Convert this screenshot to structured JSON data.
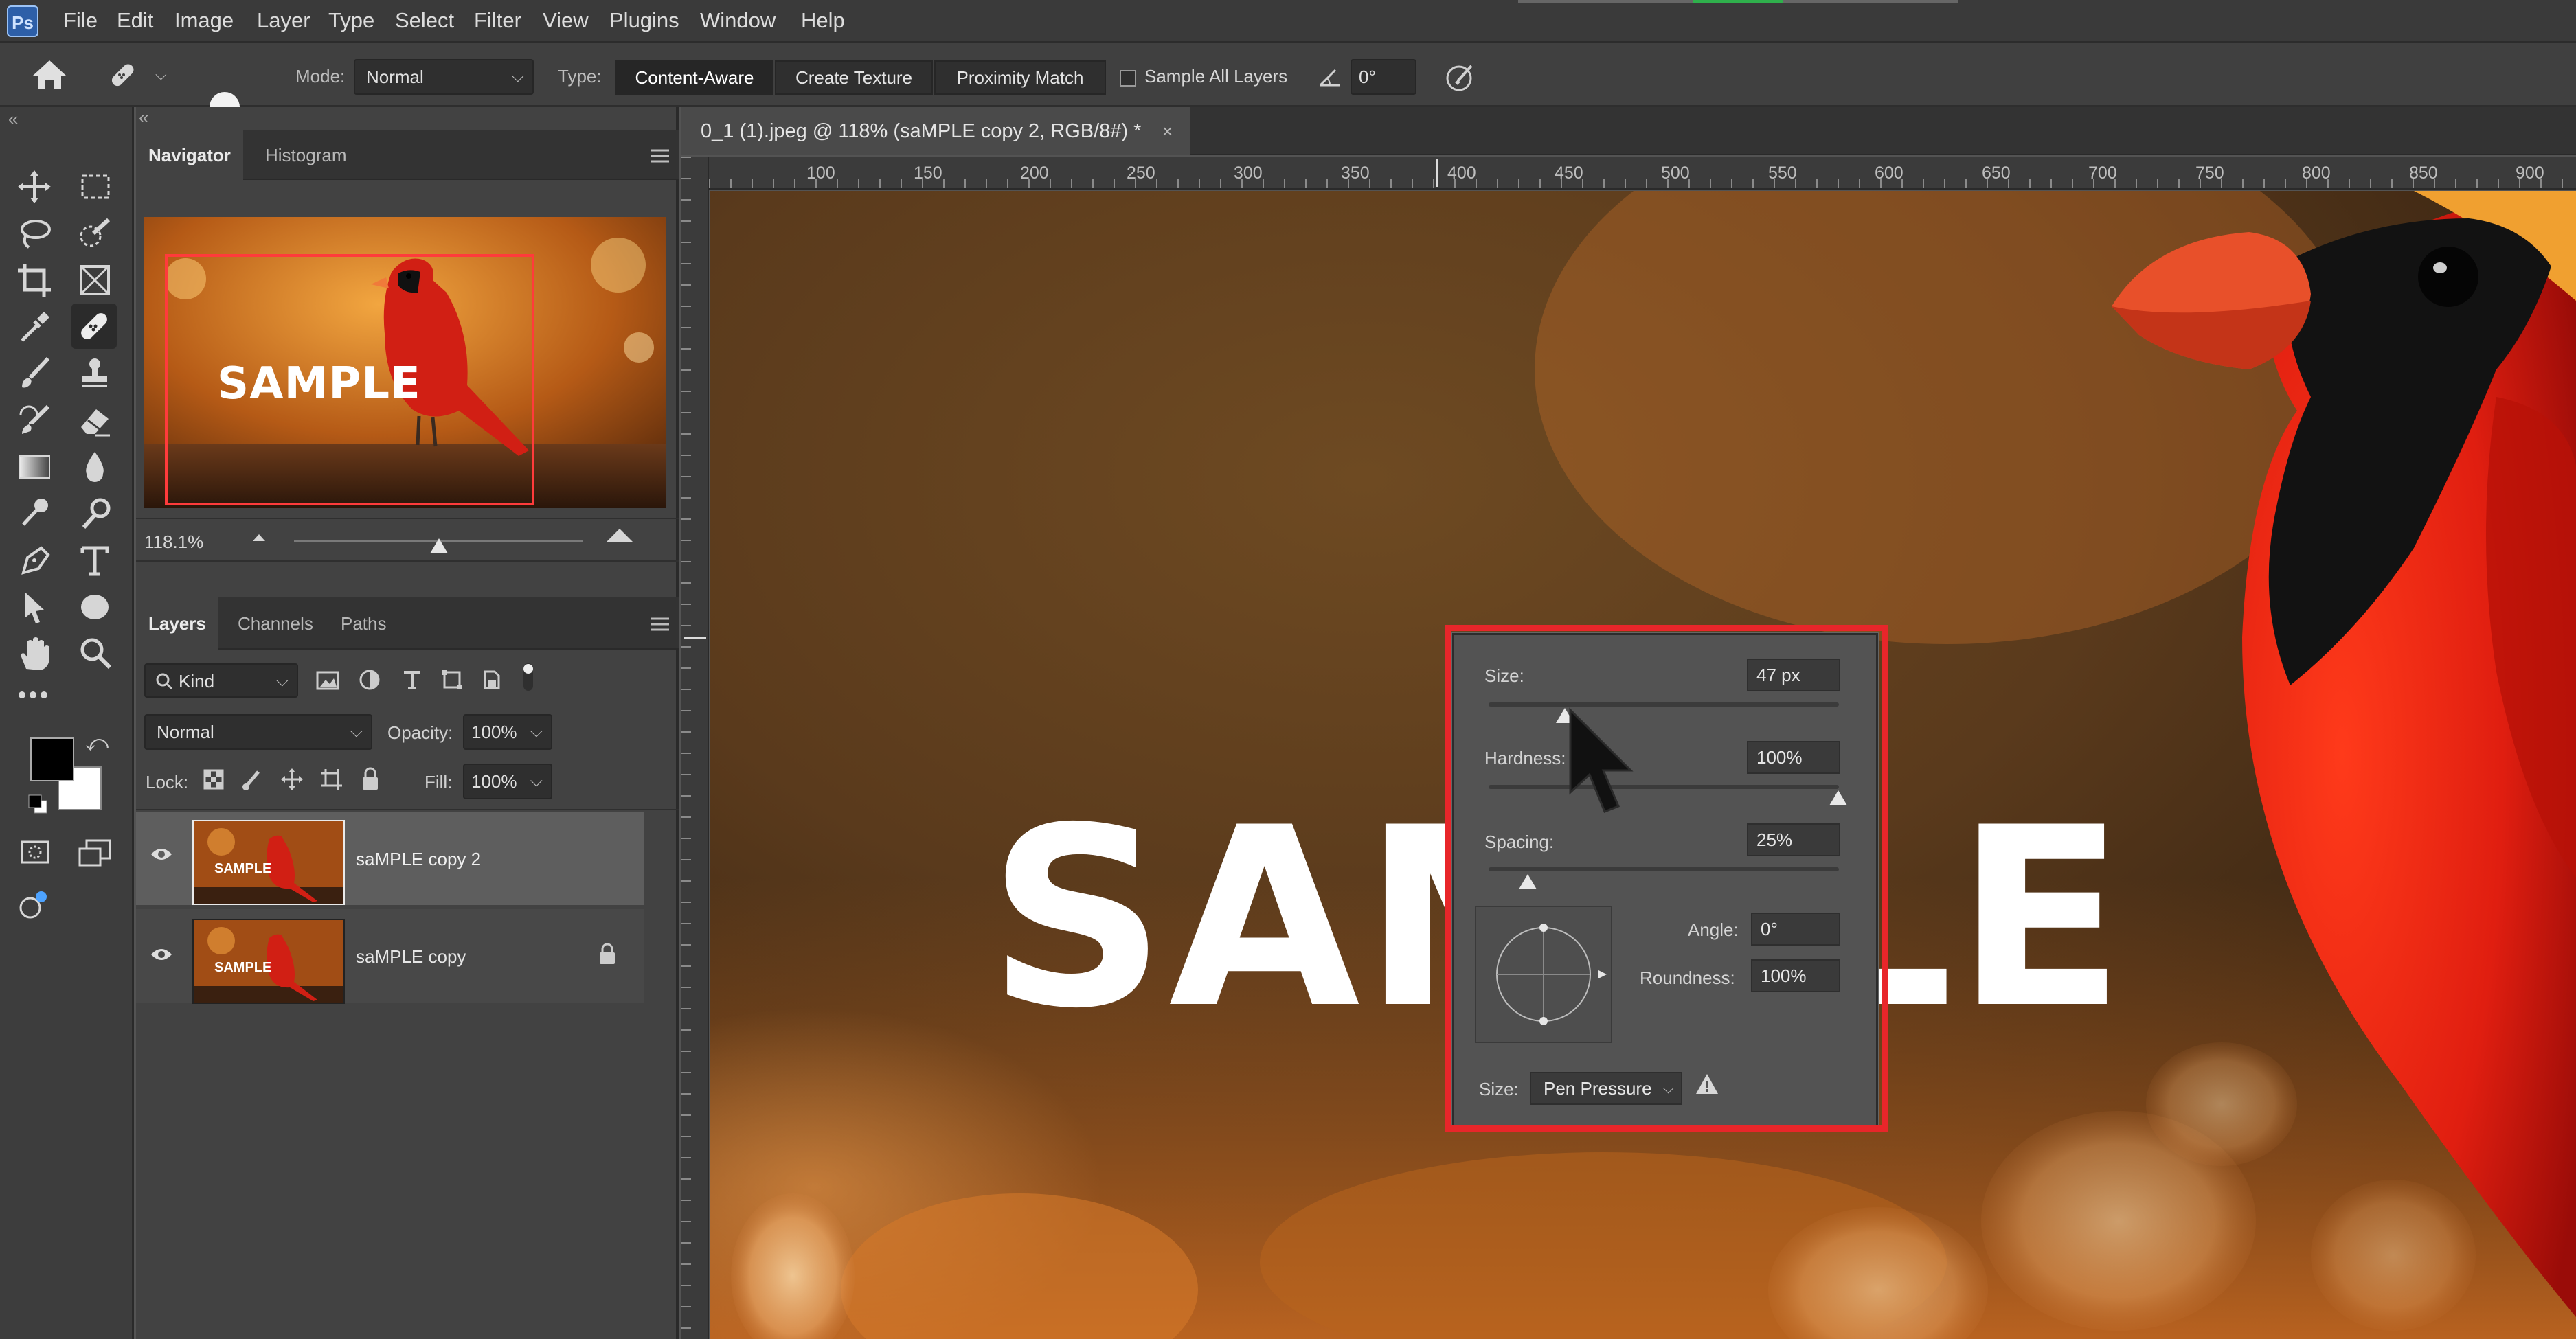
{
  "menubar": {
    "logo": "Ps",
    "items": [
      "File",
      "Edit",
      "Image",
      "Layer",
      "Type",
      "Select",
      "Filter",
      "View",
      "Plugins",
      "Window",
      "Help"
    ]
  },
  "options_bar": {
    "brush_size": "47",
    "mode_label": "Mode:",
    "mode_value": "Normal",
    "type_label": "Type:",
    "type_buttons": [
      "Content-Aware",
      "Create Texture",
      "Proximity Match"
    ],
    "sample_all_layers": "Sample All Layers",
    "angle_value": "0°"
  },
  "navigator": {
    "tabs": [
      "Navigator",
      "Histogram"
    ],
    "zoom": "118.1%",
    "preview_text": "SAMPLE"
  },
  "layers_panel": {
    "tabs": [
      "Layers",
      "Channels",
      "Paths"
    ],
    "kind_label": "Kind",
    "blend_mode": "Normal",
    "opacity_label": "Opacity:",
    "opacity_value": "100%",
    "lock_label": "Lock:",
    "fill_label": "Fill:",
    "fill_value": "100%",
    "layers": [
      {
        "name": "saMPLE copy 2",
        "thumb_text": "SAMPLE"
      },
      {
        "name": "saMPLE copy",
        "thumb_text": "SAMPLE"
      }
    ]
  },
  "document": {
    "tab_title": "0_1 (1).jpeg @ 118% (saMPLE copy 2, RGB/8#) *",
    "ruler_numbers": [
      "100",
      "150",
      "200",
      "250",
      "300",
      "350",
      "400",
      "450",
      "500",
      "550",
      "600",
      "650",
      "700",
      "750",
      "800",
      "850",
      "900"
    ],
    "canvas_text": "SAMPLE"
  },
  "brush_popup": {
    "size_label": "Size:",
    "size_value": "47 px",
    "hardness_label": "Hardness:",
    "hardness_value": "100%",
    "spacing_label": "Spacing:",
    "spacing_value": "25%",
    "angle_label": "Angle:",
    "angle_value": "0°",
    "roundness_label": "Roundness:",
    "roundness_value": "100%",
    "size_control_label": "Size:",
    "size_control_value": "Pen Pressure"
  },
  "colors": {
    "accent_highlight": "#e8262a",
    "foreground": "#000000",
    "background": "#ffffff"
  }
}
